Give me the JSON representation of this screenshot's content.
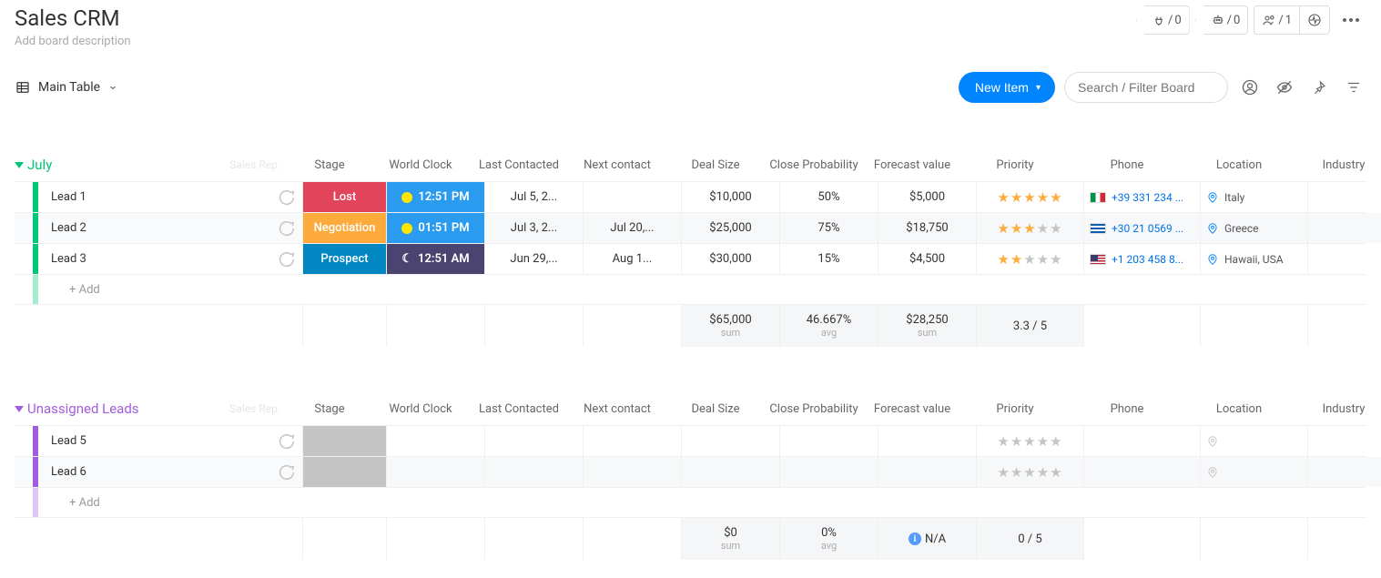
{
  "header": {
    "title": "Sales CRM",
    "description": "Add board description",
    "plug_count": "0",
    "auto_count": "0",
    "people_count": "1"
  },
  "toolbar": {
    "view_label": "Main Table",
    "new_item_label": "New Item",
    "search_placeholder": "Search / Filter Board"
  },
  "columns": {
    "subcol": "Sales Rep.",
    "stage": "Stage",
    "clock": "World Clock",
    "last": "Last Contacted",
    "next": "Next contact",
    "deal": "Deal Size",
    "close": "Close Probability",
    "forecast": "Forecast value",
    "priority": "Priority",
    "phone": "Phone",
    "location": "Location",
    "industry": "Industry"
  },
  "groups": [
    {
      "name": "July",
      "color": "#00c875",
      "rows": [
        {
          "name": "Lead 1",
          "stage": {
            "label": "Lost",
            "bg": "#e2445c"
          },
          "clock": {
            "label": "12:51 PM",
            "bg": "#2b9bf0",
            "icon": "#ffe600"
          },
          "last": "Jul 5, 2...",
          "next": "",
          "deal": "$10,000",
          "close": "50%",
          "forecast": "$5,000",
          "stars_on": 5,
          "stars_off": 0,
          "phone": "+39 331 234 ...",
          "flag": "it",
          "location": "Italy"
        },
        {
          "name": "Lead 2",
          "stage": {
            "label": "Negotiation",
            "bg": "#fdab3d"
          },
          "clock": {
            "label": "01:51 PM",
            "bg": "#2b9bf0",
            "icon": "#ffe600"
          },
          "last": "Jul 3, 2...",
          "next": "Jul 20,...",
          "deal": "$25,000",
          "close": "75%",
          "forecast": "$18,750",
          "stars_on": 3,
          "stars_off": 2,
          "phone": "+30 21 0569 ...",
          "flag": "gr",
          "location": "Greece"
        },
        {
          "name": "Lead 3",
          "stage": {
            "label": "Prospect",
            "bg": "#0086c0"
          },
          "clock": {
            "label": "12:51 AM",
            "bg": "#4b4471",
            "icon_moon": true
          },
          "last": "Jun 29,...",
          "next": "Aug 1...",
          "deal": "$30,000",
          "close": "15%",
          "forecast": "$4,500",
          "stars_on": 2,
          "stars_off": 3,
          "phone": "+1 203 458 8...",
          "flag": "us",
          "location": "Hawaii, USA"
        }
      ],
      "add_label": "+ Add",
      "summary": {
        "deal": "$65,000",
        "deal_sub": "sum",
        "close": "46.667%",
        "close_sub": "avg",
        "forecast": "$28,250",
        "forecast_sub": "sum",
        "priority": "3.3 / 5"
      }
    },
    {
      "name": "Unassigned Leads",
      "color": "#a25ddc",
      "rows": [
        {
          "name": "Lead 5",
          "empty_stage": true,
          "stars_on": 0,
          "stars_off": 5,
          "empty_loc": true
        },
        {
          "name": "Lead 6",
          "empty_stage": true,
          "stars_on": 0,
          "stars_off": 5,
          "empty_loc": true
        }
      ],
      "add_label": "+ Add",
      "summary": {
        "deal": "$0",
        "deal_sub": "sum",
        "close": "0%",
        "close_sub": "avg",
        "forecast_na": "N/A",
        "priority": "0 / 5"
      }
    }
  ]
}
